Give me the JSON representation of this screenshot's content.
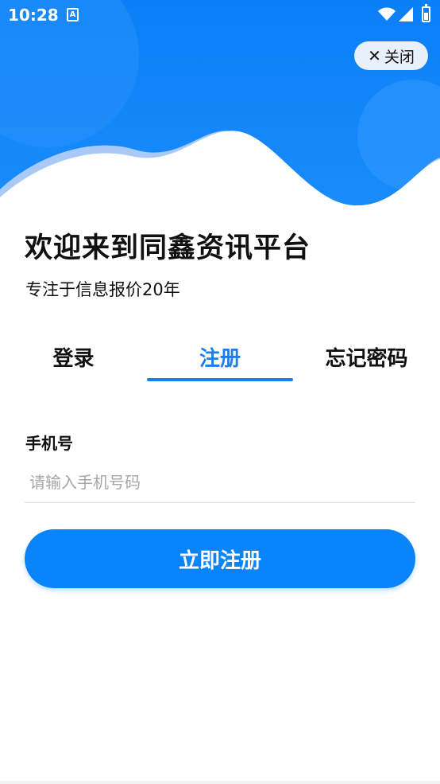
{
  "status_bar": {
    "time": "10:28",
    "notification_glyph": "A",
    "icons": [
      "notification-icon",
      "wifi-icon",
      "signal-icon",
      "battery-icon"
    ]
  },
  "header": {
    "close_label": "关闭",
    "close_icon": "close-icon"
  },
  "welcome": {
    "title": "欢迎来到同鑫资讯平台",
    "subtitle": "专注于信息报价20年"
  },
  "tabs": [
    {
      "label": "登录",
      "active": false
    },
    {
      "label": "注册",
      "active": true
    },
    {
      "label": "忘记密码",
      "active": false
    }
  ],
  "form": {
    "phone_label": "手机号",
    "phone_value": "",
    "phone_placeholder": "请输入手机号码",
    "submit_label": "立即注册"
  },
  "colors": {
    "accent": "#1e7ee8",
    "button": "#0a84fa",
    "hero_blue": "#0a84fa",
    "hero_light": "#cfe3fb"
  }
}
